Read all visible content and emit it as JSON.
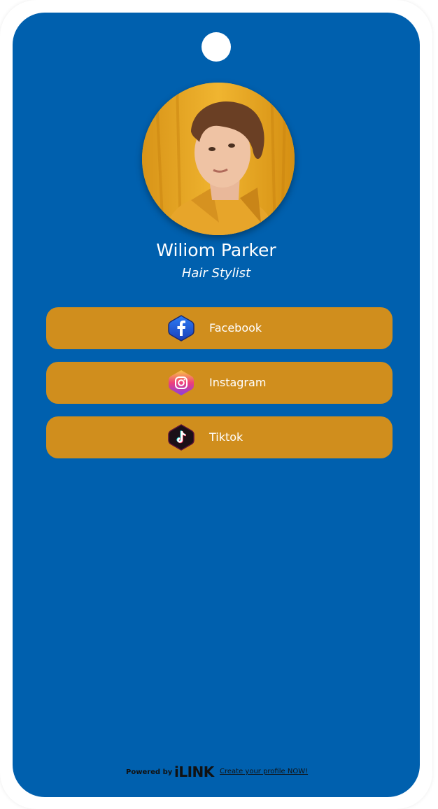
{
  "profile": {
    "name": "Wiliom Parker",
    "title": "Hair Stylist"
  },
  "links": [
    {
      "label": "Facebook",
      "icon": "facebook-icon"
    },
    {
      "label": "Instagram",
      "icon": "instagram-icon"
    },
    {
      "label": "Tiktok",
      "icon": "tiktok-icon"
    }
  ],
  "footer": {
    "powered_by": "Powered by",
    "brand": "iLINK",
    "cta": "Create your profile NOW!"
  },
  "colors": {
    "card_background": "#0060ae",
    "button_background": "#d08e1d",
    "text": "#ffffff"
  }
}
